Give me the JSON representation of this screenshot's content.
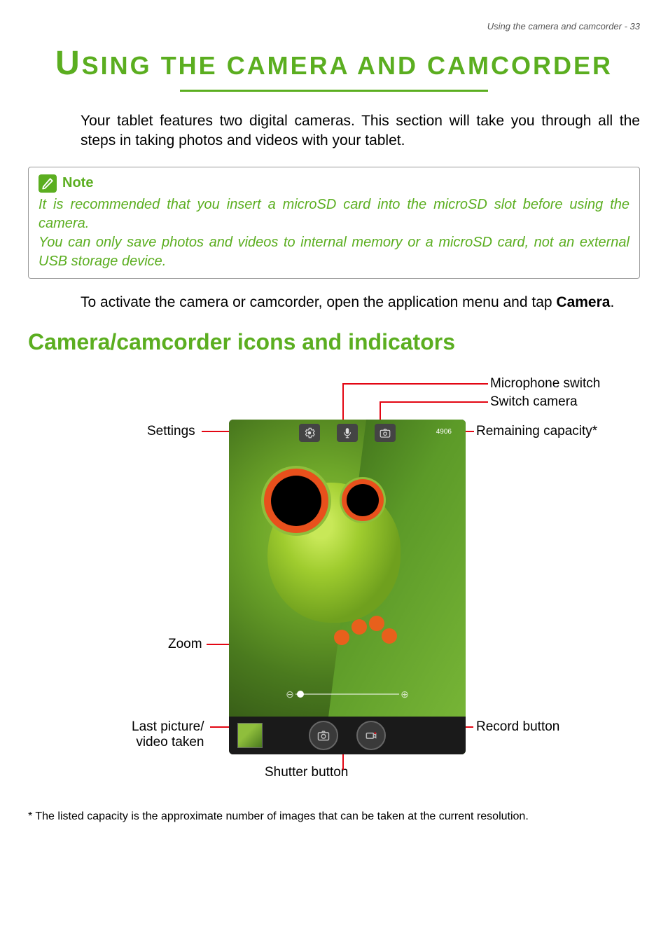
{
  "header": {
    "running_head": "Using the camera and camcorder - 33"
  },
  "title": {
    "first": "U",
    "rest": "SING THE CAMERA AND CAMCORDER"
  },
  "intro": "Your tablet features two digital cameras. This section will take you through all the steps in taking photos and videos with your tablet.",
  "note": {
    "title": "Note",
    "line1": "It is recommended that you insert a microSD card into the microSD slot before using the camera.",
    "line2": "You can only save photos and videos to internal memory or a microSD card, not an external USB storage device."
  },
  "activate": {
    "pre": "To activate the camera or camcorder, open the application menu and tap ",
    "bold": "Camera",
    "post": "."
  },
  "section_heading": "Camera/camcorder icons and indicators",
  "labels": {
    "microphone_switch": "Microphone switch",
    "switch_camera": "Switch camera",
    "settings": "Settings",
    "remaining_capacity": "Remaining capacity*",
    "zoom": "Zoom",
    "last_picture": "Last picture/",
    "video_taken": "video taken",
    "record_button": "Record button",
    "shutter_button": "Shutter button"
  },
  "camera_ui": {
    "remaining_count": "4906"
  },
  "footnote": "* The listed capacity is the approximate number of images that can be taken at the current resolution."
}
